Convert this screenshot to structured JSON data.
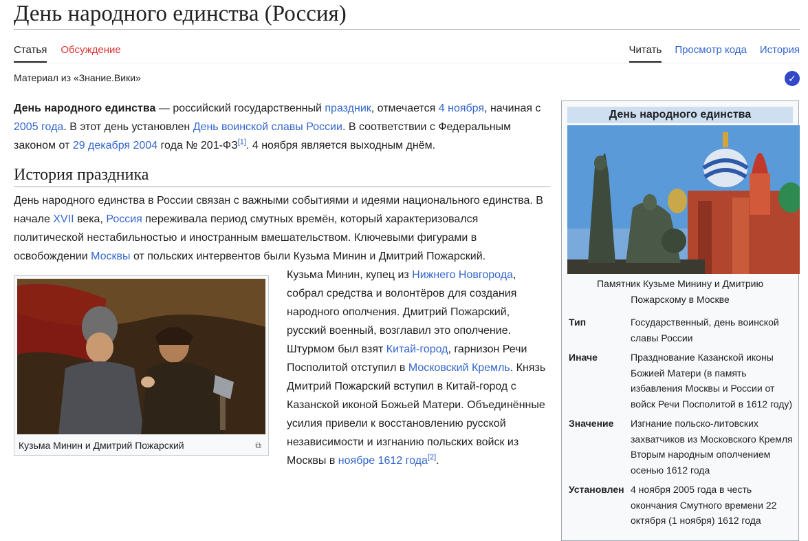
{
  "page": {
    "title": "День народного единства (Россия)",
    "tabs_left": [
      "Статья",
      "Обсуждение"
    ],
    "tabs_right": [
      "Читать",
      "Просмотр кода",
      "История"
    ],
    "from_wiki": "Материал из «Знание.Вики»",
    "verified_icon": "check-icon"
  },
  "intro": {
    "bold": "День народного единства",
    "t1": " — российский государственный ",
    "l1": "праздник",
    "t2": ", отмечается ",
    "l2": "4 ноября",
    "t3": ", начиная с ",
    "l3": "2005 года",
    "t4": ". В этот день установлен ",
    "l4": "День воинской славы России",
    "t5": ". В соответствии с Федеральным законом от ",
    "l5": "29 декабря 2004",
    "t6": " года № 201-ФЗ",
    "ref1": "[1]",
    "t7": ". 4 ноября является выходным днём."
  },
  "history": {
    "heading": "История праздника",
    "p1": {
      "t1": "День народного единства в России связан с важными событиями и идеями национального единства. В начале ",
      "l1": "XVII",
      "t2": " века, ",
      "l2": "Россия",
      "t3": " переживала период смутных времён, который характеризовался политической нестабильностью и иностранным вмешательством. Ключевыми фигурами в освобождении ",
      "l3": "Москвы",
      "t4": " от польских интервентов были Кузьма Минин и Дмитрий Пожарский."
    },
    "thumb_caption": "Кузьма Минин и Дмитрий Пожарский",
    "p2": {
      "t1": "Кузьма Минин, купец из ",
      "l1": "Нижнего Новгорода",
      "t2": ", собрал средства и волонтёров для создания народного ополчения. Дмитрий Пожарский, русский военный, возглавил это ополчение. Штурмом был взят ",
      "l2": "Китай-город",
      "t3": ", гарнизон Речи Посполитой отступил в ",
      "l3": "Московский Кремль",
      "t4": ". Князь Дмитрий Пожарский вступил в Китай-город с Казанской иконой Божьей Матери. Объединённые усилия привели к восстановлению русской независимости и изгнанию польских войск из Москвы в ",
      "l4": "ноябре 1612 года",
      "ref2": "[2]",
      "t5": "."
    }
  },
  "infobox": {
    "title": "День народного единства",
    "caption": "Памятник Кузьме Минину и Дмитрию Пожарскому в Москве",
    "rows": [
      {
        "label": "Тип",
        "value": "Государственный, день воинской славы России"
      },
      {
        "label": "Иначе",
        "value": "Празднование Казанской иконы Божией Матери (в память избавления Москвы и России от войск Речи Посполитой в 1612 году)"
      },
      {
        "label": "Значение",
        "value": "Изгнание польско-литовских захватчиков из Московского Кремля Вторым народным ополчением осенью 1612 года"
      },
      {
        "label": "Установлен",
        "value": "4 ноября 2005 года в честь окончания Смутного времени 22 октября (1 ноября) 1612 года"
      }
    ]
  }
}
